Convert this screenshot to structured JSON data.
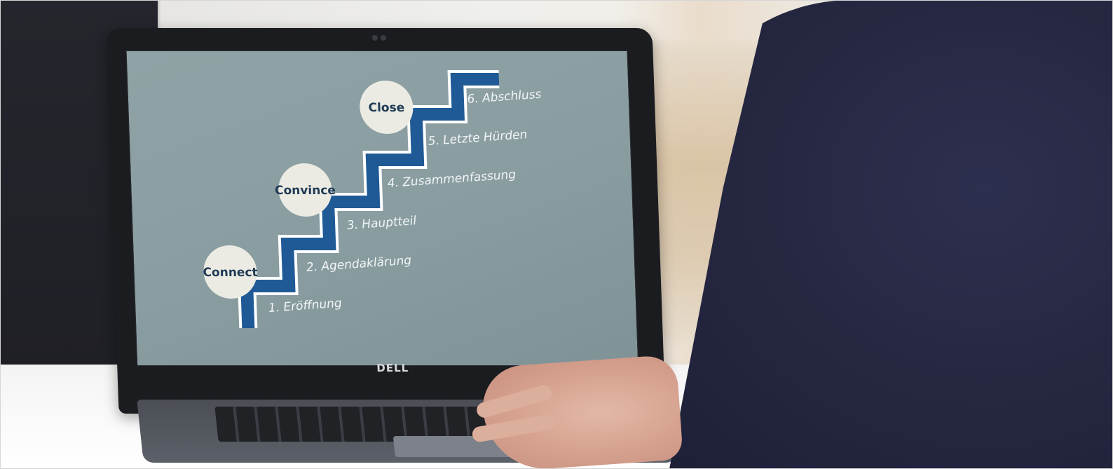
{
  "laptop": {
    "brand": "DELL"
  },
  "slide": {
    "stages": [
      {
        "label": "Connect"
      },
      {
        "label": "Convince"
      },
      {
        "label": "Close"
      }
    ],
    "steps": [
      {
        "label": "1. Eröffnung"
      },
      {
        "label": "2. Agendaklärung"
      },
      {
        "label": "3. Hauptteil"
      },
      {
        "label": "4. Zusammenfassung"
      },
      {
        "label": "5. Letzte Hürden"
      },
      {
        "label": "6. Abschluss"
      }
    ],
    "colors": {
      "background": "#8fa2a5",
      "stair": "#1f5a96",
      "stair_outline": "#ffffff",
      "circle": "#ecebe3",
      "circle_text": "#1f3b56"
    }
  }
}
